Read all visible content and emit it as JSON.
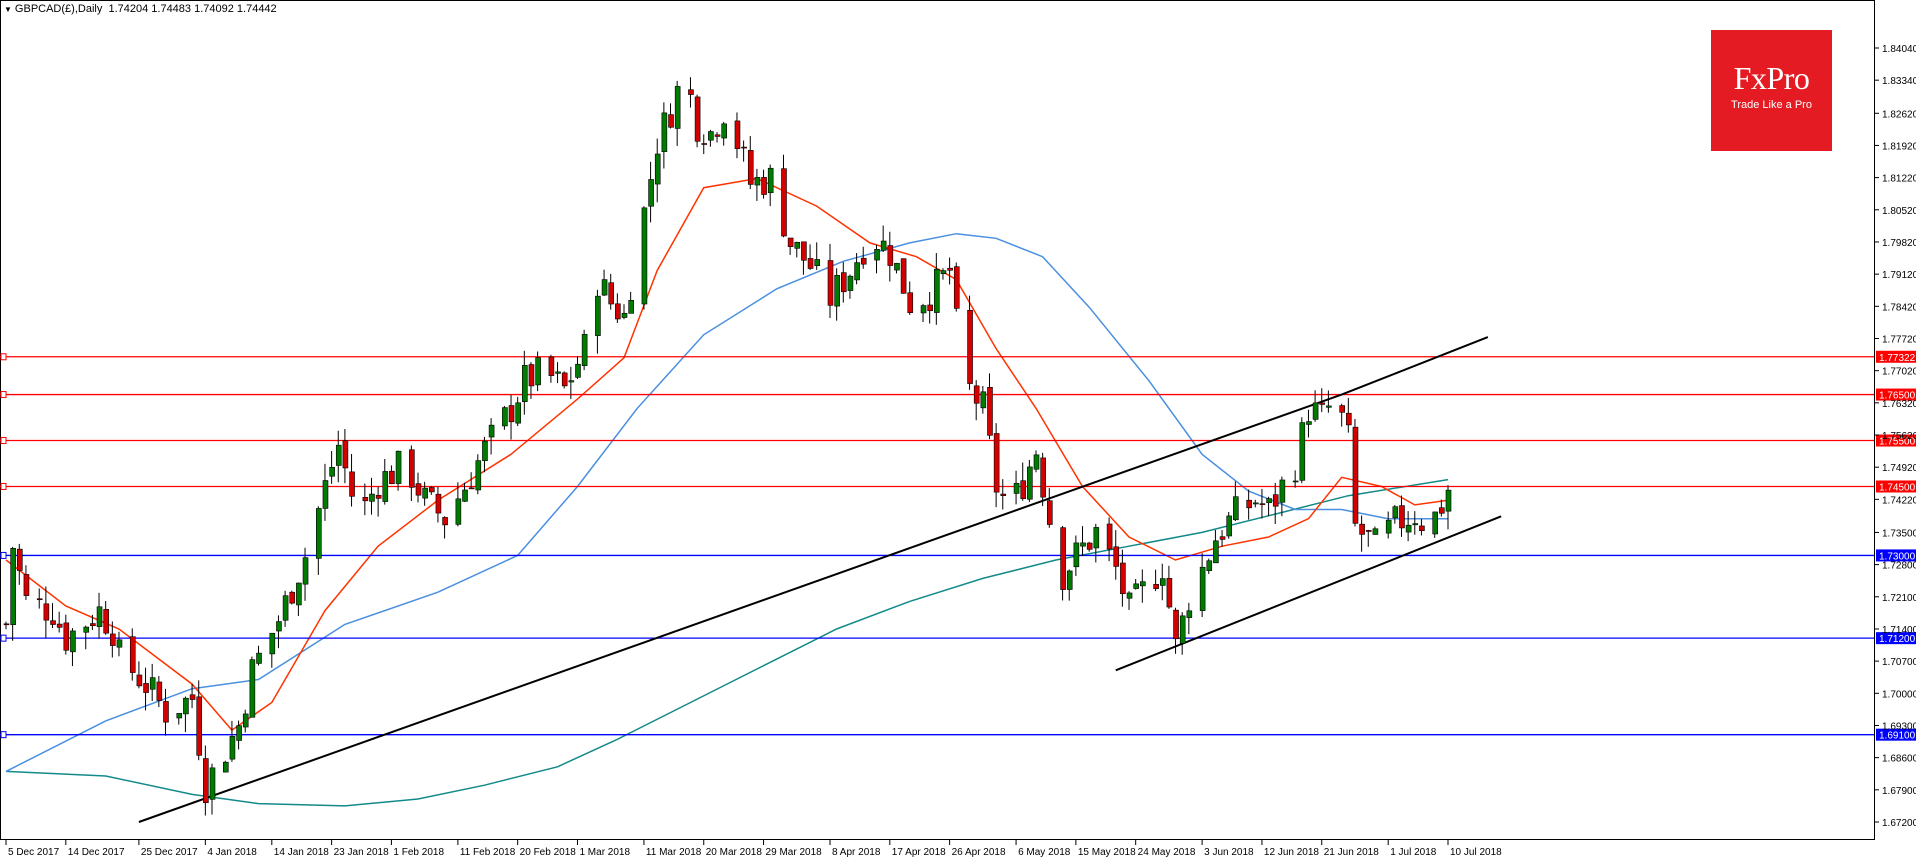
{
  "header": {
    "symbol_timeframe": "GBPCAD(£),Daily",
    "ohlc": "1.74204 1.74483 1.74092 1.74442"
  },
  "logo": {
    "brand": "FxPro",
    "tagline": "Trade Like a Pro"
  },
  "colors": {
    "bull": "#007a00",
    "bear": "#d40000",
    "wick": "#000000",
    "ma_fast": "#ff3300",
    "ma_mid": "#4a8fe0",
    "ma_slow": "#138a8a",
    "resistance": "#ff0000",
    "support": "#0000ff",
    "trendline": "#000000"
  },
  "chart_data": {
    "type": "candlestick",
    "y_axis": {
      "min": 1.672,
      "max": 1.8475,
      "tick_labels": [
        "1.84040",
        "1.83340",
        "1.82620",
        "1.81920",
        "1.81220",
        "1.80520",
        "1.79820",
        "1.79120",
        "1.78420",
        "1.77720",
        "1.77020",
        "1.76320",
        "1.75620",
        "1.74920",
        "1.74220",
        "1.73500",
        "1.72800",
        "1.72100",
        "1.71400",
        "1.70700",
        "1.70000",
        "1.69300",
        "1.68600",
        "1.67900",
        "1.67200"
      ]
    },
    "x_axis": {
      "start_date": "2017-12-05",
      "end_date": "2018-07-10",
      "tick_labels": [
        "5 Dec 2017",
        "14 Dec 2017",
        "25 Dec 2017",
        "4 Jan 2018",
        "14 Jan 2018",
        "23 Jan 2018",
        "1 Feb 2018",
        "11 Feb 2018",
        "20 Feb 2018",
        "1 Mar 2018",
        "11 Mar 2018",
        "20 Mar 2018",
        "29 Mar 2018",
        "8 Apr 2018",
        "17 Apr 2018",
        "26 Apr 2018",
        "6 May 2018",
        "15 May 2018",
        "24 May 2018",
        "3 Jun 2018",
        "12 Jun 2018",
        "21 Jun 2018",
        "1 Jul 2018",
        "10 Jul 2018"
      ]
    },
    "close_path": [
      [
        "2017-12-05",
        1.715
      ],
      [
        "2017-12-06",
        1.732
      ],
      [
        "2017-12-08",
        1.72
      ],
      [
        "2017-12-12",
        1.718
      ],
      [
        "2017-12-14",
        1.712
      ],
      [
        "2017-12-19",
        1.718
      ],
      [
        "2017-12-21",
        1.714
      ],
      [
        "2017-12-22",
        1.708
      ],
      [
        "2017-12-26",
        1.702
      ],
      [
        "2017-12-29",
        1.696
      ],
      [
        "2018-01-02",
        1.699
      ],
      [
        "2018-01-04",
        1.68
      ],
      [
        "2018-01-06",
        1.685
      ],
      [
        "2018-01-09",
        1.693
      ],
      [
        "2018-01-11",
        1.705
      ],
      [
        "2018-01-15",
        1.716
      ],
      [
        "2018-01-19",
        1.73
      ],
      [
        "2018-01-22",
        1.745
      ],
      [
        "2018-01-24",
        1.754
      ],
      [
        "2018-01-27",
        1.738
      ],
      [
        "2018-01-30",
        1.746
      ],
      [
        "2018-02-03",
        1.75
      ],
      [
        "2018-02-06",
        1.742
      ],
      [
        "2018-02-09",
        1.738
      ],
      [
        "2018-02-12",
        1.745
      ],
      [
        "2018-02-15",
        1.753
      ],
      [
        "2018-02-19",
        1.762
      ],
      [
        "2018-02-21",
        1.768
      ],
      [
        "2018-02-24",
        1.77
      ],
      [
        "2018-02-27",
        1.766
      ],
      [
        "2018-03-02",
        1.775
      ],
      [
        "2018-03-04",
        1.79
      ],
      [
        "2018-03-06",
        1.785
      ],
      [
        "2018-03-08",
        1.782
      ],
      [
        "2018-03-10",
        1.797
      ],
      [
        "2018-03-13",
        1.82
      ],
      [
        "2018-03-15",
        1.827
      ],
      [
        "2018-03-17",
        1.835
      ],
      [
        "2018-03-19",
        1.824
      ],
      [
        "2018-03-21",
        1.822
      ],
      [
        "2018-03-23",
        1.827
      ],
      [
        "2018-03-25",
        1.82
      ],
      [
        "2018-03-27",
        1.811
      ],
      [
        "2018-03-30",
        1.812
      ],
      [
        "2018-04-02",
        1.798
      ],
      [
        "2018-04-05",
        1.793
      ],
      [
        "2018-04-08",
        1.786
      ],
      [
        "2018-04-11",
        1.792
      ],
      [
        "2018-04-14",
        1.8
      ],
      [
        "2018-04-17",
        1.796
      ],
      [
        "2018-04-20",
        1.785
      ],
      [
        "2018-04-23",
        1.787
      ],
      [
        "2018-04-26",
        1.792
      ],
      [
        "2018-04-28",
        1.768
      ],
      [
        "2018-05-01",
        1.762
      ],
      [
        "2018-05-03",
        1.745
      ],
      [
        "2018-05-05",
        1.74
      ],
      [
        "2018-05-07",
        1.746
      ],
      [
        "2018-05-09",
        1.753
      ],
      [
        "2018-05-11",
        1.738
      ],
      [
        "2018-05-13",
        1.726
      ],
      [
        "2018-05-15",
        1.73
      ],
      [
        "2018-05-18",
        1.735
      ],
      [
        "2018-05-21",
        1.727
      ],
      [
        "2018-05-23",
        1.718
      ],
      [
        "2018-05-26",
        1.724
      ],
      [
        "2018-05-28",
        1.728
      ],
      [
        "2018-05-30",
        1.71
      ],
      [
        "2018-06-01",
        1.721
      ],
      [
        "2018-06-03",
        1.727
      ],
      [
        "2018-06-05",
        1.734
      ],
      [
        "2018-06-08",
        1.739
      ],
      [
        "2018-06-11",
        1.742
      ],
      [
        "2018-06-13",
        1.74
      ],
      [
        "2018-06-15",
        1.745
      ],
      [
        "2018-06-17",
        1.75
      ],
      [
        "2018-06-19",
        1.762
      ],
      [
        "2018-06-21",
        1.76
      ],
      [
        "2018-06-23",
        1.764
      ],
      [
        "2018-06-25",
        1.755
      ],
      [
        "2018-06-26",
        1.736
      ],
      [
        "2018-06-29",
        1.732
      ],
      [
        "2018-07-02",
        1.737
      ],
      [
        "2018-07-05",
        1.739
      ],
      [
        "2018-07-07",
        1.736
      ],
      [
        "2018-07-09",
        1.741
      ],
      [
        "2018-07-10",
        1.7444
      ]
    ],
    "moving_averages": {
      "fast_red": [
        [
          "2017-12-05",
          1.729
        ],
        [
          "2017-12-14",
          1.719
        ],
        [
          "2017-12-22",
          1.714
        ],
        [
          "2018-01-02",
          1.702
        ],
        [
          "2018-01-08",
          1.692
        ],
        [
          "2018-01-14",
          1.698
        ],
        [
          "2018-01-22",
          1.718
        ],
        [
          "2018-01-30",
          1.732
        ],
        [
          "2018-02-08",
          1.742
        ],
        [
          "2018-02-19",
          1.752
        ],
        [
          "2018-03-01",
          1.764
        ],
        [
          "2018-03-08",
          1.773
        ],
        [
          "2018-03-13",
          1.792
        ],
        [
          "2018-03-20",
          1.81
        ],
        [
          "2018-03-28",
          1.812
        ],
        [
          "2018-04-06",
          1.806
        ],
        [
          "2018-04-14",
          1.798
        ],
        [
          "2018-04-21",
          1.795
        ],
        [
          "2018-04-27",
          1.79
        ],
        [
          "2018-05-03",
          1.775
        ],
        [
          "2018-05-09",
          1.762
        ],
        [
          "2018-05-16",
          1.745
        ],
        [
          "2018-05-23",
          1.734
        ],
        [
          "2018-05-30",
          1.729
        ],
        [
          "2018-06-06",
          1.732
        ],
        [
          "2018-06-13",
          1.734
        ],
        [
          "2018-06-19",
          1.738
        ],
        [
          "2018-06-24",
          1.747
        ],
        [
          "2018-06-30",
          1.745
        ],
        [
          "2018-07-05",
          1.741
        ],
        [
          "2018-07-10",
          1.742
        ]
      ],
      "mid_blue": [
        [
          "2017-12-05",
          1.683
        ],
        [
          "2017-12-20",
          1.694
        ],
        [
          "2018-01-02",
          1.701
        ],
        [
          "2018-01-12",
          1.703
        ],
        [
          "2018-01-25",
          1.715
        ],
        [
          "2018-02-08",
          1.722
        ],
        [
          "2018-02-20",
          1.73
        ],
        [
          "2018-03-01",
          1.745
        ],
        [
          "2018-03-10",
          1.762
        ],
        [
          "2018-03-20",
          1.778
        ],
        [
          "2018-03-31",
          1.788
        ],
        [
          "2018-04-10",
          1.794
        ],
        [
          "2018-04-20",
          1.798
        ],
        [
          "2018-04-27",
          1.8
        ],
        [
          "2018-05-03",
          1.799
        ],
        [
          "2018-05-10",
          1.795
        ],
        [
          "2018-05-17",
          1.784
        ],
        [
          "2018-05-26",
          1.768
        ],
        [
          "2018-06-03",
          1.752
        ],
        [
          "2018-06-10",
          1.744
        ],
        [
          "2018-06-17",
          1.74
        ],
        [
          "2018-06-24",
          1.74
        ],
        [
          "2018-07-01",
          1.738
        ],
        [
          "2018-07-10",
          1.738
        ]
      ],
      "slow_teal": [
        [
          "2017-12-05",
          1.683
        ],
        [
          "2017-12-20",
          1.682
        ],
        [
          "2018-01-02",
          1.678
        ],
        [
          "2018-01-12",
          1.676
        ],
        [
          "2018-01-25",
          1.6755
        ],
        [
          "2018-02-05",
          1.677
        ],
        [
          "2018-02-15",
          1.68
        ],
        [
          "2018-02-26",
          1.684
        ],
        [
          "2018-03-07",
          1.69
        ],
        [
          "2018-03-18",
          1.698
        ],
        [
          "2018-03-29",
          1.706
        ],
        [
          "2018-04-09",
          1.714
        ],
        [
          "2018-04-20",
          1.72
        ],
        [
          "2018-05-01",
          1.725
        ],
        [
          "2018-05-12",
          1.729
        ],
        [
          "2018-05-23",
          1.732
        ],
        [
          "2018-06-03",
          1.735
        ],
        [
          "2018-06-14",
          1.739
        ],
        [
          "2018-06-25",
          1.743
        ],
        [
          "2018-07-10",
          1.7465
        ]
      ]
    },
    "horizontal_levels": [
      {
        "label": "1.77322",
        "price": 1.77322,
        "kind": "resistance"
      },
      {
        "label": "1.76500",
        "price": 1.765,
        "kind": "resistance"
      },
      {
        "label": "1.75500",
        "price": 1.755,
        "kind": "resistance"
      },
      {
        "label": "1.74500",
        "price": 1.745,
        "kind": "resistance"
      },
      {
        "label": "1.73000",
        "price": 1.73,
        "kind": "support"
      },
      {
        "label": "1.71200",
        "price": 1.712,
        "kind": "support"
      },
      {
        "label": "1.69100",
        "price": 1.691,
        "kind": "support"
      }
    ],
    "trendlines": [
      {
        "from": [
          "2017-12-25",
          1.672
        ],
        "to": [
          "2018-06-24",
          1.765
        ]
      },
      {
        "from": [
          "2018-06-24",
          1.765
        ],
        "to": [
          "2018-07-16",
          1.7775
        ]
      },
      {
        "from": [
          "2018-05-21",
          1.705
        ],
        "to": [
          "2018-07-18",
          1.7385
        ]
      }
    ]
  }
}
